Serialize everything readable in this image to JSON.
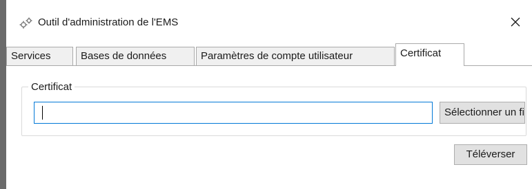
{
  "window": {
    "title": "Outil d'administration de l'EMS"
  },
  "tabs": [
    {
      "label": "Services"
    },
    {
      "label": "Bases de données"
    },
    {
      "label": "Paramètres de compte utilisateur"
    },
    {
      "label": "Certificat",
      "active": true
    }
  ],
  "certificate": {
    "group_label": "Certificat",
    "input_value": "",
    "select_button": "Sélectionner un fichier"
  },
  "actions": {
    "upload_label": "Téléverser"
  },
  "colors": {
    "focus_border": "#0078d7",
    "button_bg": "#e1e1e1",
    "tab_bg": "#f0f0f0"
  },
  "icons": {
    "app": "gears-icon",
    "close": "close-icon"
  }
}
